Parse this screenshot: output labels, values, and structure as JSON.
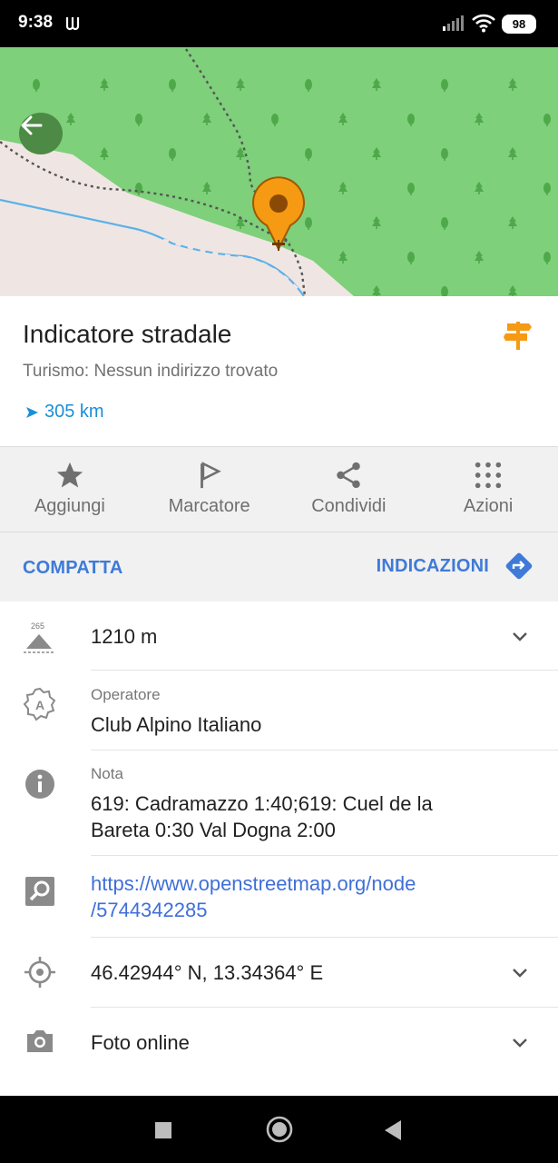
{
  "status_bar": {
    "time": "9:38",
    "battery": "98"
  },
  "map": {
    "land_color": "#7ed07a",
    "road_color": "#efe6e4",
    "marker_color": "#f59a12"
  },
  "poi": {
    "title": "Indicatore stradale",
    "subtitle": "Turismo: Nessun indirizzo trovato",
    "distance": "305 km",
    "type_icon": "signpost-icon"
  },
  "actions": [
    {
      "label": "Aggiungi",
      "icon": "star-icon"
    },
    {
      "label": "Marcatore",
      "icon": "flag-icon"
    },
    {
      "label": "Condividi",
      "icon": "share-icon"
    },
    {
      "label": "Azioni",
      "icon": "grid-dots-icon"
    }
  ],
  "nav": {
    "compact": "COMPATTA",
    "directions": "INDICAZIONI"
  },
  "details": {
    "altitude": {
      "badge": "265",
      "value": "1210 m"
    },
    "operator": {
      "label": "Operatore",
      "value": "Club Alpino Italiano"
    },
    "note": {
      "label": "Nota",
      "value_line1": "619: Cadramazzo 1:40;619: Cuel de la",
      "value_line2": "Bareta 0:30 Val Dogna 2:00"
    },
    "link": {
      "line1": "https://www.openstreetmap.org/node",
      "line2": "/5744342285"
    },
    "coordinates": {
      "value": "46.42944° N, 13.34364° E"
    },
    "photos": {
      "value": "Foto online"
    }
  },
  "colors": {
    "accent": "#3f7ad8",
    "distance": "#1a8fd8",
    "orange": "#f59a12"
  }
}
